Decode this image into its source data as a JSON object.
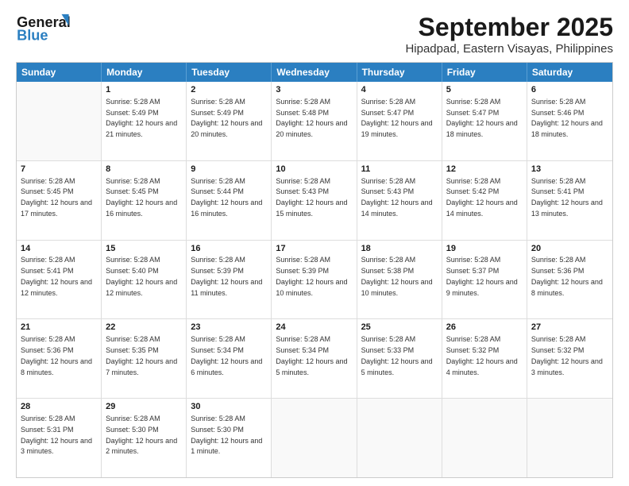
{
  "logo": {
    "line1": "General",
    "line2": "Blue"
  },
  "title": "September 2025",
  "subtitle": "Hipadpad, Eastern Visayas, Philippines",
  "weekdays": [
    "Sunday",
    "Monday",
    "Tuesday",
    "Wednesday",
    "Thursday",
    "Friday",
    "Saturday"
  ],
  "rows": [
    [
      {
        "day": "",
        "sunrise": "",
        "sunset": "",
        "daylight": ""
      },
      {
        "day": "1",
        "sunrise": "Sunrise: 5:28 AM",
        "sunset": "Sunset: 5:49 PM",
        "daylight": "Daylight: 12 hours and 21 minutes."
      },
      {
        "day": "2",
        "sunrise": "Sunrise: 5:28 AM",
        "sunset": "Sunset: 5:49 PM",
        "daylight": "Daylight: 12 hours and 20 minutes."
      },
      {
        "day": "3",
        "sunrise": "Sunrise: 5:28 AM",
        "sunset": "Sunset: 5:48 PM",
        "daylight": "Daylight: 12 hours and 20 minutes."
      },
      {
        "day": "4",
        "sunrise": "Sunrise: 5:28 AM",
        "sunset": "Sunset: 5:47 PM",
        "daylight": "Daylight: 12 hours and 19 minutes."
      },
      {
        "day": "5",
        "sunrise": "Sunrise: 5:28 AM",
        "sunset": "Sunset: 5:47 PM",
        "daylight": "Daylight: 12 hours and 18 minutes."
      },
      {
        "day": "6",
        "sunrise": "Sunrise: 5:28 AM",
        "sunset": "Sunset: 5:46 PM",
        "daylight": "Daylight: 12 hours and 18 minutes."
      }
    ],
    [
      {
        "day": "7",
        "sunrise": "Sunrise: 5:28 AM",
        "sunset": "Sunset: 5:45 PM",
        "daylight": "Daylight: 12 hours and 17 minutes."
      },
      {
        "day": "8",
        "sunrise": "Sunrise: 5:28 AM",
        "sunset": "Sunset: 5:45 PM",
        "daylight": "Daylight: 12 hours and 16 minutes."
      },
      {
        "day": "9",
        "sunrise": "Sunrise: 5:28 AM",
        "sunset": "Sunset: 5:44 PM",
        "daylight": "Daylight: 12 hours and 16 minutes."
      },
      {
        "day": "10",
        "sunrise": "Sunrise: 5:28 AM",
        "sunset": "Sunset: 5:43 PM",
        "daylight": "Daylight: 12 hours and 15 minutes."
      },
      {
        "day": "11",
        "sunrise": "Sunrise: 5:28 AM",
        "sunset": "Sunset: 5:43 PM",
        "daylight": "Daylight: 12 hours and 14 minutes."
      },
      {
        "day": "12",
        "sunrise": "Sunrise: 5:28 AM",
        "sunset": "Sunset: 5:42 PM",
        "daylight": "Daylight: 12 hours and 14 minutes."
      },
      {
        "day": "13",
        "sunrise": "Sunrise: 5:28 AM",
        "sunset": "Sunset: 5:41 PM",
        "daylight": "Daylight: 12 hours and 13 minutes."
      }
    ],
    [
      {
        "day": "14",
        "sunrise": "Sunrise: 5:28 AM",
        "sunset": "Sunset: 5:41 PM",
        "daylight": "Daylight: 12 hours and 12 minutes."
      },
      {
        "day": "15",
        "sunrise": "Sunrise: 5:28 AM",
        "sunset": "Sunset: 5:40 PM",
        "daylight": "Daylight: 12 hours and 12 minutes."
      },
      {
        "day": "16",
        "sunrise": "Sunrise: 5:28 AM",
        "sunset": "Sunset: 5:39 PM",
        "daylight": "Daylight: 12 hours and 11 minutes."
      },
      {
        "day": "17",
        "sunrise": "Sunrise: 5:28 AM",
        "sunset": "Sunset: 5:39 PM",
        "daylight": "Daylight: 12 hours and 10 minutes."
      },
      {
        "day": "18",
        "sunrise": "Sunrise: 5:28 AM",
        "sunset": "Sunset: 5:38 PM",
        "daylight": "Daylight: 12 hours and 10 minutes."
      },
      {
        "day": "19",
        "sunrise": "Sunrise: 5:28 AM",
        "sunset": "Sunset: 5:37 PM",
        "daylight": "Daylight: 12 hours and 9 minutes."
      },
      {
        "day": "20",
        "sunrise": "Sunrise: 5:28 AM",
        "sunset": "Sunset: 5:36 PM",
        "daylight": "Daylight: 12 hours and 8 minutes."
      }
    ],
    [
      {
        "day": "21",
        "sunrise": "Sunrise: 5:28 AM",
        "sunset": "Sunset: 5:36 PM",
        "daylight": "Daylight: 12 hours and 8 minutes."
      },
      {
        "day": "22",
        "sunrise": "Sunrise: 5:28 AM",
        "sunset": "Sunset: 5:35 PM",
        "daylight": "Daylight: 12 hours and 7 minutes."
      },
      {
        "day": "23",
        "sunrise": "Sunrise: 5:28 AM",
        "sunset": "Sunset: 5:34 PM",
        "daylight": "Daylight: 12 hours and 6 minutes."
      },
      {
        "day": "24",
        "sunrise": "Sunrise: 5:28 AM",
        "sunset": "Sunset: 5:34 PM",
        "daylight": "Daylight: 12 hours and 5 minutes."
      },
      {
        "day": "25",
        "sunrise": "Sunrise: 5:28 AM",
        "sunset": "Sunset: 5:33 PM",
        "daylight": "Daylight: 12 hours and 5 minutes."
      },
      {
        "day": "26",
        "sunrise": "Sunrise: 5:28 AM",
        "sunset": "Sunset: 5:32 PM",
        "daylight": "Daylight: 12 hours and 4 minutes."
      },
      {
        "day": "27",
        "sunrise": "Sunrise: 5:28 AM",
        "sunset": "Sunset: 5:32 PM",
        "daylight": "Daylight: 12 hours and 3 minutes."
      }
    ],
    [
      {
        "day": "28",
        "sunrise": "Sunrise: 5:28 AM",
        "sunset": "Sunset: 5:31 PM",
        "daylight": "Daylight: 12 hours and 3 minutes."
      },
      {
        "day": "29",
        "sunrise": "Sunrise: 5:28 AM",
        "sunset": "Sunset: 5:30 PM",
        "daylight": "Daylight: 12 hours and 2 minutes."
      },
      {
        "day": "30",
        "sunrise": "Sunrise: 5:28 AM",
        "sunset": "Sunset: 5:30 PM",
        "daylight": "Daylight: 12 hours and 1 minute."
      },
      {
        "day": "",
        "sunrise": "",
        "sunset": "",
        "daylight": ""
      },
      {
        "day": "",
        "sunrise": "",
        "sunset": "",
        "daylight": ""
      },
      {
        "day": "",
        "sunrise": "",
        "sunset": "",
        "daylight": ""
      },
      {
        "day": "",
        "sunrise": "",
        "sunset": "",
        "daylight": ""
      }
    ]
  ]
}
